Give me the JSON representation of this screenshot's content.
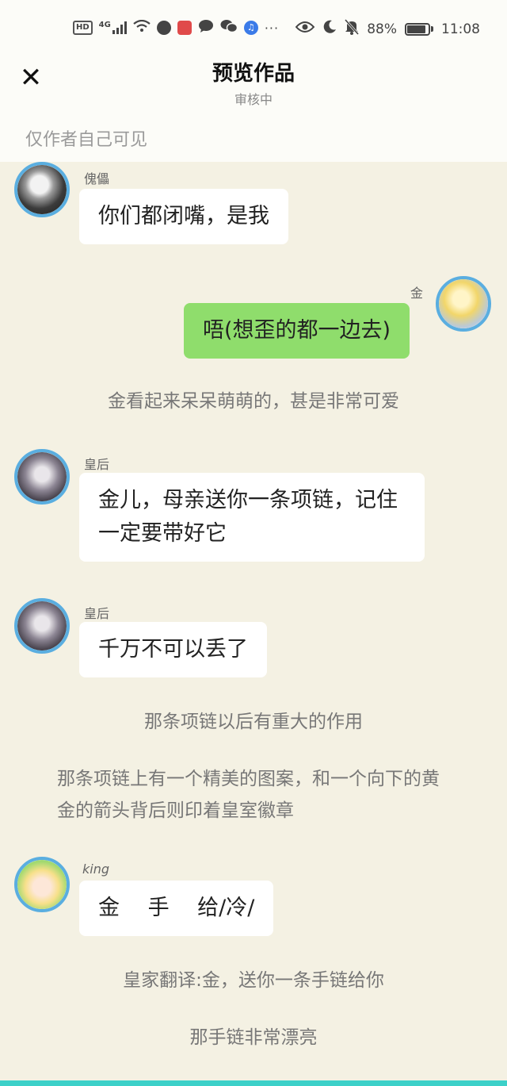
{
  "status_bar": {
    "hd": "HD",
    "network": "4G",
    "battery": "88%",
    "time": "11:08"
  },
  "header": {
    "close_icon": "close-icon",
    "title": "预览作品",
    "subtitle": "审核中"
  },
  "visibility_note": "仅作者自己可见",
  "messages": [
    {
      "name": "傀儡",
      "text": "你们都闭嘴，是我"
    },
    {
      "name": "金",
      "text": "唔(想歪的都一边去)"
    },
    {
      "narration": "金看起来呆呆萌萌的，甚是非常可爱"
    },
    {
      "name": "皇后",
      "text": "金儿，母亲送你一条项链，记住一定要带好它"
    },
    {
      "name": "皇后",
      "text": "千万不可以丢了"
    },
    {
      "narration": "那条项链以后有重大的作用"
    },
    {
      "narration": "那条项链上有一个精美的图案，和一个向下的黄金的箭头背后则印着皇室徽章"
    },
    {
      "name": "king",
      "text": "金　 手　 给/冷/"
    },
    {
      "narration": "皇家翻译:金，送你一条手链给你"
    },
    {
      "narration": "那手链非常漂亮"
    }
  ],
  "colors": {
    "background": "#f4f1e3",
    "header_bg": "#fcfcf8",
    "bubble_white": "#ffffff",
    "bubble_green": "#8fdd6c",
    "avatar_ring": "#5aaee0"
  }
}
